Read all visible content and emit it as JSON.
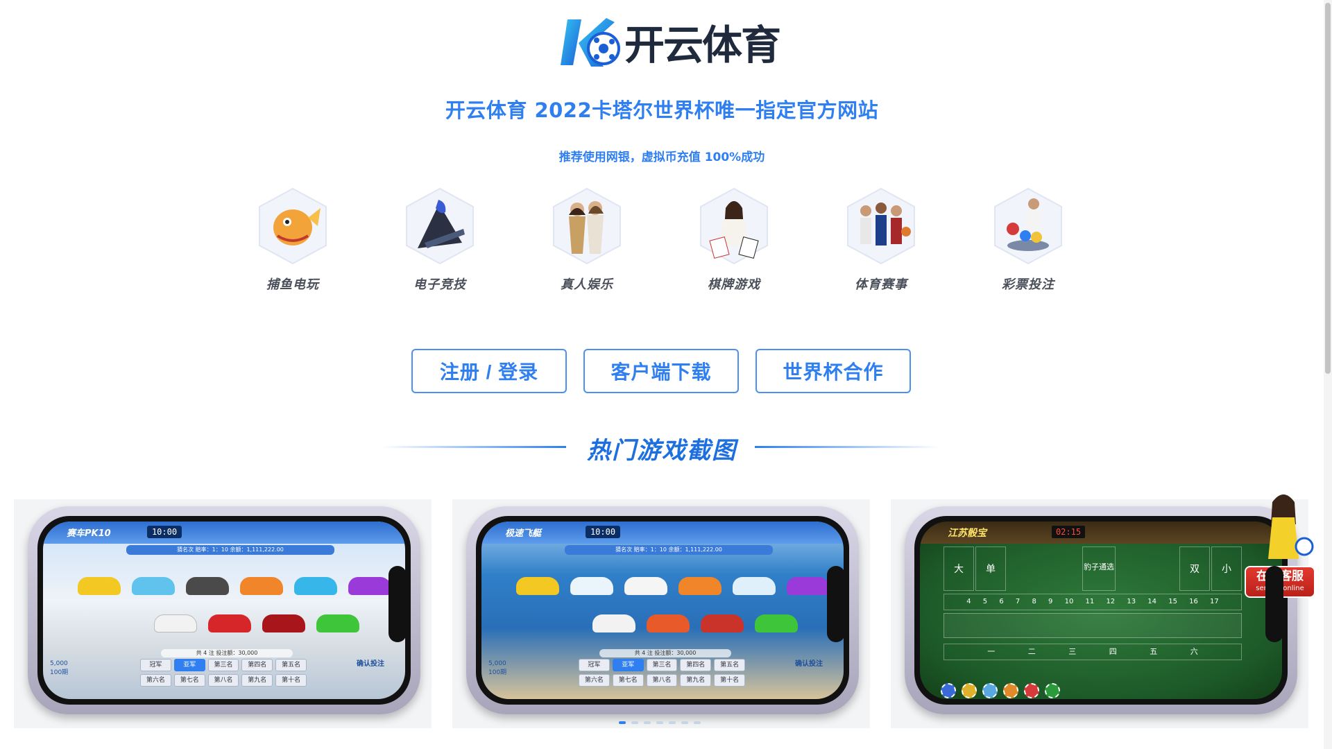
{
  "brand": {
    "name": "开云体育",
    "logo_letters": "K",
    "colors": {
      "primary": "#2f7ff0",
      "text_dark": "#1f2a3c"
    }
  },
  "headline": "开云体育 2022卡塔尔世界杯唯一指定官方网站",
  "subline": "推荐使用网银，虚拟币充值 100%成功",
  "categories": [
    {
      "label": "捕鱼电玩",
      "icon": "fish-game-icon"
    },
    {
      "label": "电子竞技",
      "icon": "esports-icon"
    },
    {
      "label": "真人娱乐",
      "icon": "live-casino-icon"
    },
    {
      "label": "棋牌游戏",
      "icon": "card-games-icon"
    },
    {
      "label": "体育赛事",
      "icon": "sports-icon"
    },
    {
      "label": "彩票投注",
      "icon": "lottery-icon"
    }
  ],
  "buttons": {
    "register_login": "注册 / 登录",
    "client_download": "客户端下载",
    "world_cup": "世界杯合作"
  },
  "section_title": "热门游戏截图",
  "screenshots": [
    {
      "game": "赛车PK10",
      "timer": "10:00",
      "info": "猜名次 赔率：1：10 余额：1,111,222.00",
      "summary": "共 4 注 投注额：30,000",
      "balance": "5,000",
      "periods": "100期",
      "confirm": "确认投注",
      "ranks": [
        "冠军",
        "亚军",
        "第三名",
        "第四名",
        "第五名",
        "第六名",
        "第七名",
        "第八名",
        "第九名",
        "第十名"
      ],
      "active_rank": 1
    },
    {
      "game": "极速飞艇",
      "timer": "10:00",
      "info": "猜名次 赔率：1：10 余额：1,111,222.00",
      "summary": "共 4 注 投注额：30,000",
      "balance": "5,000",
      "periods": "100期",
      "confirm": "确认投注",
      "ranks": [
        "冠军",
        "亚军",
        "第三名",
        "第四名",
        "第五名",
        "第六名",
        "第七名",
        "第八名",
        "第九名",
        "第十名"
      ],
      "active_rank": 1
    },
    {
      "game": "江苏骰宝",
      "timer": "02:15",
      "cells": [
        "大",
        "单",
        "豹子通选",
        "双",
        "小"
      ],
      "sums": [
        "4",
        "5",
        "6",
        "7",
        "8",
        "9",
        "10",
        "11",
        "12",
        "13",
        "14",
        "15",
        "16",
        "17"
      ],
      "bottom": [
        "一",
        "二",
        "三",
        "四",
        "五",
        "六"
      ]
    }
  ],
  "carousel": {
    "count": 7,
    "active": 0
  },
  "customer_service": {
    "label": "在线客服",
    "sub": "service online"
  }
}
